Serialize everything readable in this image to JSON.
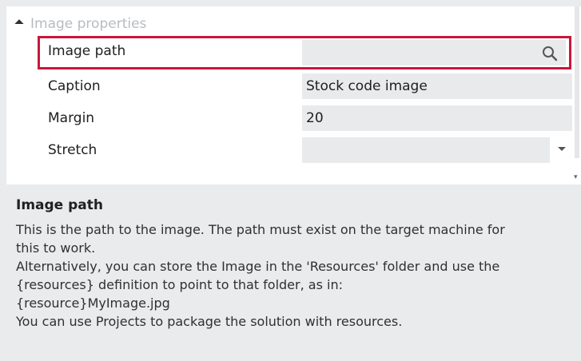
{
  "section": {
    "title": "Image properties",
    "collapse_icon": "triangle-collapse-icon"
  },
  "properties": [
    {
      "label": "Image path",
      "value": "",
      "icon": "search-icon"
    },
    {
      "label": "Caption",
      "value": "Stock code image"
    },
    {
      "label": "Margin",
      "value": "20"
    },
    {
      "label": "Stretch",
      "value": "",
      "icon": "chevron-down-icon"
    }
  ],
  "highlight_color": "#c8163d",
  "description": {
    "title": "Image path",
    "text": "This is the path to the image. The path must exist on the target machine for\nthis to work.\nAlternatively, you can store the Image in the 'Resources' folder and use the\n{resources} definition to point to that folder, as in:\n      {resource}MyImage.jpg\nYou can use Projects to package the solution with resources."
  }
}
